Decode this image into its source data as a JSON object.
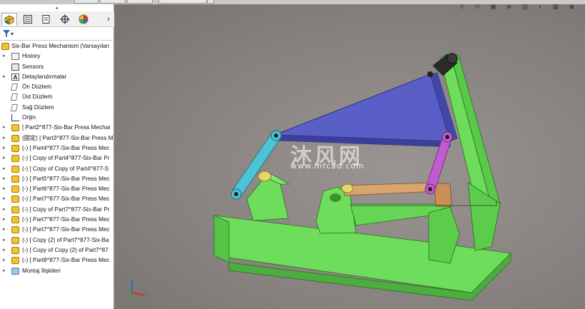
{
  "top_tabs": [
    "",
    "",
    "",
    "",
    ""
  ],
  "panel": {
    "tabs": [
      "feature-manager",
      "property-manager",
      "configuration-manager",
      "dimxpert-manager",
      "display-manager"
    ],
    "more": "›",
    "filter_caret": "▾"
  },
  "tree": {
    "root_label": "Six-Bar Press Mechanism  (Varsayılan",
    "items": [
      {
        "label": "History",
        "icon": "history-icon"
      },
      {
        "label": "Sensors",
        "icon": "sensors-icon"
      },
      {
        "label": "Detaylandırmalar",
        "icon": "annotations-icon"
      },
      {
        "label": "Ön Düzlem",
        "icon": "plane-icon"
      },
      {
        "label": "Üst Düzlem",
        "icon": "plane-icon"
      },
      {
        "label": "Sağ Düzlem",
        "icon": "plane-icon"
      },
      {
        "label": "Orijin",
        "icon": "origin-icon"
      },
      {
        "label": "[ Part2^877-Six-Bar Press Mechar",
        "icon": "part-icon"
      },
      {
        "label": "(固定) [ Part3^877-Six-Bar Press M",
        "icon": "part-icon"
      },
      {
        "label": "(-) [ Part4^877-Six-Bar Press Mec",
        "icon": "part-icon"
      },
      {
        "label": "(-) [ Copy of Part4^877-Six-Bar Pr",
        "icon": "part-icon"
      },
      {
        "label": "(-) [ Copy of Copy of Part4^877-S",
        "icon": "part-icon"
      },
      {
        "label": "(-) [ Part5^877-Six-Bar Press Mec",
        "icon": "part-icon"
      },
      {
        "label": "(-) [ Part6^877-Six-Bar Press Mec",
        "icon": "part-icon"
      },
      {
        "label": "(-) [ Part7^877-Six-Bar Press Mec",
        "icon": "part-icon"
      },
      {
        "label": "(-) [ Copy of Part7^877-Six-Bar Pr",
        "icon": "part-icon"
      },
      {
        "label": "(-) [ Part7^877-Six-Bar Press Mec",
        "icon": "part-icon"
      },
      {
        "label": "(-) [ Part7^877-Six-Bar Press Mec",
        "icon": "part-icon"
      },
      {
        "label": "(-) [ Copy (2) of Part7^877-Six-Ba",
        "icon": "part-icon"
      },
      {
        "label": "(-) [ Copy of Copy (2) of Part7^87",
        "icon": "part-icon"
      },
      {
        "label": "(-) [ Part8^877-Six-Bar Press Mec",
        "icon": "part-icon"
      },
      {
        "label": "Montaj İlişkileri",
        "icon": "mates-icon"
      }
    ]
  },
  "viewport": {
    "watermark_cn": "沐风网",
    "watermark_url": "www.mfcad.com"
  },
  "colors": {
    "base": "#7cf06a",
    "triangle": "#5a5fc8",
    "link_cyan": "#4dc3d6",
    "link_magenta": "#c25ad0",
    "slider_tan": "#d9a56e"
  }
}
